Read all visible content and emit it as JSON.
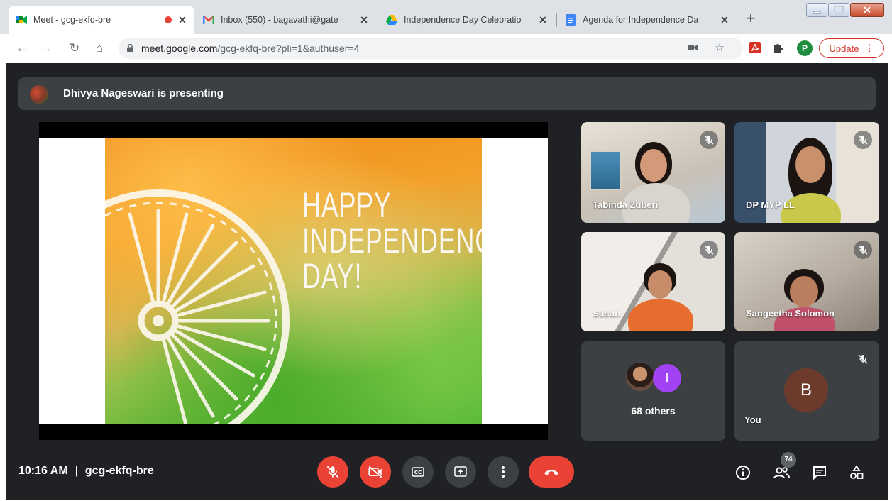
{
  "browser": {
    "tabs": [
      {
        "title": "Meet - gcg-ekfq-bre",
        "active": true,
        "recording": true
      },
      {
        "title": "Inbox (550) - bagavathi@gate"
      },
      {
        "title": "Independence Day Celebratio"
      },
      {
        "title": "Agenda for Independence Da"
      }
    ],
    "close_glyph": "✕",
    "new_tab_glyph": "+",
    "url_host": "meet.google.com",
    "url_path": "/gcg-ekfq-bre?pli=1&authuser=4",
    "profile_initial": "P",
    "update_label": "Update",
    "colors": {
      "accent_red": "#d93025",
      "profile_green": "#1e8e3e"
    }
  },
  "meet": {
    "presenting_text": "Dhivya Nageswari is presenting",
    "slide": {
      "lines": [
        "HAPPY",
        "INDEPENDENCE",
        "DAY!"
      ]
    },
    "participants": [
      {
        "name": "Tabinda Zuberi",
        "muted": true
      },
      {
        "name": "DP MYP LL",
        "muted": true
      },
      {
        "name": "Susan",
        "muted": true
      },
      {
        "name": "Sangeetha Solomon",
        "muted": true
      }
    ],
    "others": {
      "avatar_initial": "I",
      "label": "68 others"
    },
    "self": {
      "initial": "B",
      "label": "You",
      "muted": true
    },
    "time": "10:16 AM",
    "meeting_code": "gcg-ekfq-bre",
    "pipe": "|",
    "participant_count": "74",
    "colors": {
      "background": "#202124",
      "tile": "#3c4043",
      "danger": "#ea4335"
    }
  }
}
